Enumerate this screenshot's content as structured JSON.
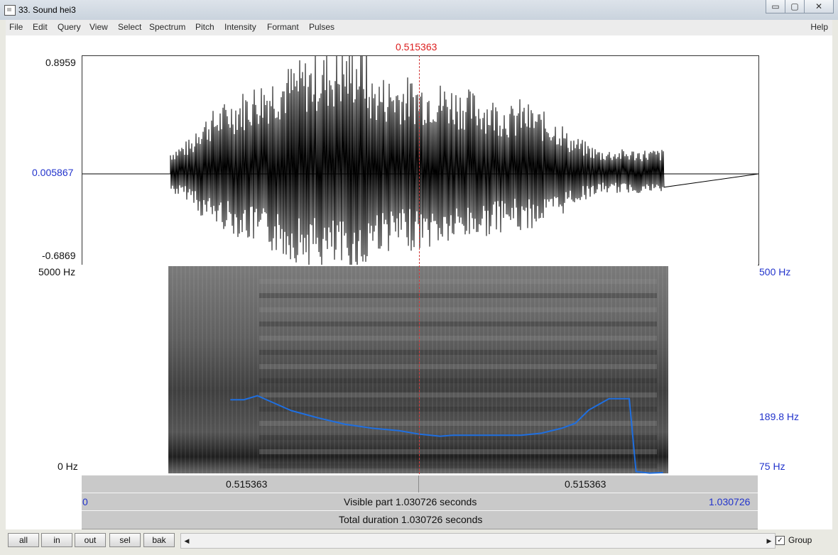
{
  "window": {
    "title": "33. Sound hei3",
    "minimize": "▭",
    "maximize": "▢",
    "close": "✕"
  },
  "menu": {
    "items": [
      "File",
      "Edit",
      "Query",
      "View",
      "Select",
      "Spectrum",
      "Pitch",
      "Intensity",
      "Formant",
      "Pulses"
    ],
    "help": "Help"
  },
  "cursor": {
    "time_label": "0.515363",
    "time": 0.515363
  },
  "waveform": {
    "max_label": "0.8959",
    "zero_label": "0.005867",
    "min_label": "-0.6869",
    "voiced_start": 0.13,
    "voiced_end": 0.86
  },
  "spectrogram": {
    "top_label": "5000 Hz",
    "bottom_label": "0 Hz",
    "pitch_top_label": "500 Hz",
    "pitch_mid_label": "189.8 Hz",
    "pitch_bottom_label": "75 Hz",
    "pitch_color": "#1f6fe0",
    "pitch_contour_hz": [
      [
        0.22,
        226
      ],
      [
        0.24,
        226
      ],
      [
        0.26,
        234
      ],
      [
        0.28,
        222
      ],
      [
        0.31,
        204
      ],
      [
        0.35,
        189
      ],
      [
        0.39,
        176
      ],
      [
        0.43,
        168
      ],
      [
        0.47,
        163
      ],
      [
        0.5,
        156
      ],
      [
        0.53,
        152
      ],
      [
        0.55,
        154
      ],
      [
        0.6,
        154
      ],
      [
        0.65,
        154
      ],
      [
        0.68,
        158
      ],
      [
        0.71,
        168
      ],
      [
        0.73,
        178
      ],
      [
        0.75,
        205
      ],
      [
        0.78,
        228
      ],
      [
        0.81,
        228
      ],
      [
        0.82,
        80
      ],
      [
        0.84,
        77
      ],
      [
        0.86,
        78
      ]
    ]
  },
  "bars": {
    "selection_left": "0.515363",
    "selection_right": "0.515363",
    "visible_start": "0",
    "visible_part": "Visible part 1.030726 seconds",
    "visible_end": "1.030726",
    "total_duration": "Total duration 1.030726 seconds"
  },
  "toolbar": {
    "all": "all",
    "in": "in",
    "out": "out",
    "sel": "sel",
    "bak": "bak",
    "scroll_left": "◀",
    "scroll_right": "▶",
    "group_label": "Group",
    "group_checked": "✓"
  },
  "colors": {
    "cursor": "#dc1e1e",
    "axis_blue": "#2233cc"
  }
}
